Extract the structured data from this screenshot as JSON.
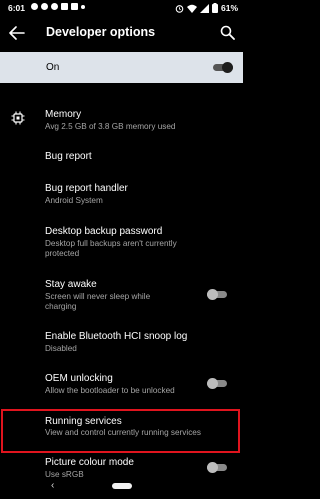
{
  "status": {
    "time": "6:01",
    "battery": "61%",
    "notification_icons": [
      "spotify-icon",
      "messenger-icon",
      "youtube-icon",
      "linkedin-icon",
      "mail-icon",
      "dot-icon"
    ]
  },
  "appbar": {
    "title": "Developer options"
  },
  "master": {
    "label": "On",
    "state": true
  },
  "items": [
    {
      "title": "Memory",
      "summary": "Avg 2.5 GB of 3.8 GB memory used"
    },
    {
      "title": "Bug report"
    },
    {
      "title": "Bug report handler",
      "summary": "Android System"
    },
    {
      "title": "Desktop backup password",
      "summary": "Desktop full backups aren't currently protected"
    },
    {
      "title": "Stay awake",
      "summary": "Screen will never sleep while charging",
      "switch": false
    },
    {
      "title": "Enable Bluetooth HCI snoop log",
      "summary": "Disabled"
    },
    {
      "title": "OEM unlocking",
      "summary": "Allow the bootloader to be unlocked",
      "switch": false
    },
    {
      "title": "Running services",
      "summary": "View and control currently running services"
    },
    {
      "title": "Picture colour mode",
      "summary": "Use sRGB",
      "switch": false
    }
  ],
  "navbar": {
    "back_glyph": "‹"
  }
}
